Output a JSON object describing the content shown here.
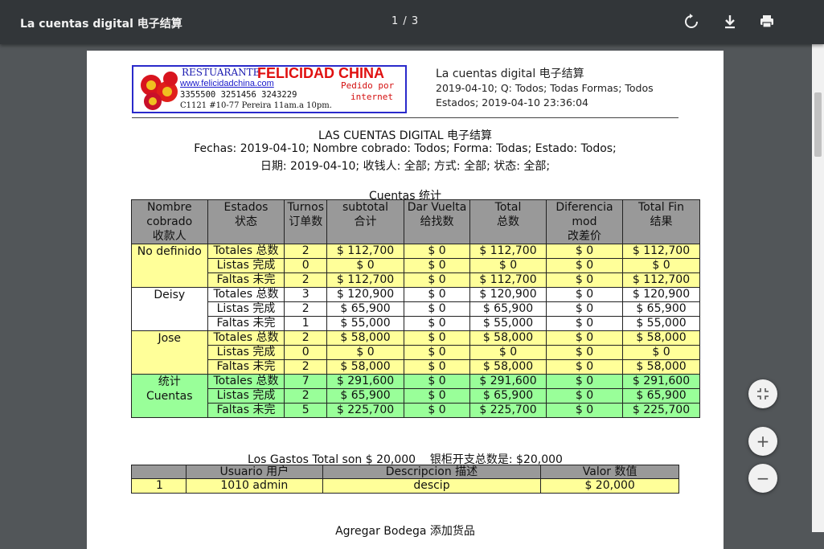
{
  "toolbar": {
    "title": "La cuentas digital 电子结算",
    "page_indicator": "1 / 3",
    "rotate_icon": "rotate-icon",
    "download_icon": "download-icon",
    "print_icon": "print-icon"
  },
  "logo": {
    "line1a": "RESTUARANTE",
    "line1b": "FELICIDAD CHINA",
    "website": "www.felicidadchina.com",
    "phones": "3355500 3251456 3243229",
    "pedido1": "Pedido por",
    "pedido2": "internet",
    "address": "C1121 #10-77 Pereira 11am.a 10pm."
  },
  "header": {
    "title": "La cuentas digital 电子结算",
    "line2": "2019-04-10; Q: Todos; Todas Formas; Todos",
    "line3": "Estados;  2019-04-10 23:36:04"
  },
  "report": {
    "title": "LAS CUENTAS DIGITAL 电子结算",
    "filters_es": "Fechas: 2019-04-10; Nombre cobrado: Todos; Forma: Todas; Estado: Todos;",
    "filters_zh": "日期: 2019-04-10; 收钱人: 全部; 方式: 全部; 状态: 全部;",
    "table_caption": "Cuentas 统计"
  },
  "columns": [
    "Nombre cobrado 收款人",
    "Estados 状态",
    "Turnos 订单数",
    "subtotal 合计",
    "Dar Vuelta 给找数",
    "Total 总数",
    "Diferencia mod 改差价",
    "Total Fin 结果"
  ],
  "groups": [
    {
      "name": "No definido",
      "rows": [
        {
          "estado": "Totales 总数",
          "turnos": "2",
          "subtotal": "$ 112,700",
          "vuelta": "$ 0",
          "total": "$ 112,700",
          "dif": "$ 0",
          "fin": "$ 112,700"
        },
        {
          "estado": "Listas 完成",
          "turnos": "0",
          "subtotal": "$ 0",
          "vuelta": "$ 0",
          "total": "$ 0",
          "dif": "$ 0",
          "fin": "$ 0"
        },
        {
          "estado": "Faltas 未完",
          "turnos": "2",
          "subtotal": "$ 112,700",
          "vuelta": "$ 0",
          "total": "$ 112,700",
          "dif": "$ 0",
          "fin": "$ 112,700"
        }
      ]
    },
    {
      "name": "Deisy",
      "rows": [
        {
          "estado": "Totales 总数",
          "turnos": "3",
          "subtotal": "$ 120,900",
          "vuelta": "$ 0",
          "total": "$ 120,900",
          "dif": "$ 0",
          "fin": "$ 120,900"
        },
        {
          "estado": "Listas 完成",
          "turnos": "2",
          "subtotal": "$ 65,900",
          "vuelta": "$ 0",
          "total": "$ 65,900",
          "dif": "$ 0",
          "fin": "$ 65,900"
        },
        {
          "estado": "Faltas 未完",
          "turnos": "1",
          "subtotal": "$ 55,000",
          "vuelta": "$ 0",
          "total": "$ 55,000",
          "dif": "$ 0",
          "fin": "$ 55,000"
        }
      ]
    },
    {
      "name": "Jose",
      "rows": [
        {
          "estado": "Totales 总数",
          "turnos": "2",
          "subtotal": "$ 58,000",
          "vuelta": "$ 0",
          "total": "$ 58,000",
          "dif": "$ 0",
          "fin": "$ 58,000"
        },
        {
          "estado": "Listas 完成",
          "turnos": "0",
          "subtotal": "$ 0",
          "vuelta": "$ 0",
          "total": "$ 0",
          "dif": "$ 0",
          "fin": "$ 0"
        },
        {
          "estado": "Faltas 未完",
          "turnos": "2",
          "subtotal": "$ 58,000",
          "vuelta": "$ 0",
          "total": "$ 58,000",
          "dif": "$ 0",
          "fin": "$ 58,000"
        }
      ]
    },
    {
      "name": "统计 Cuentas",
      "rows": [
        {
          "estado": "Totales 总数",
          "turnos": "7",
          "subtotal": "$ 291,600",
          "vuelta": "$ 0",
          "total": "$ 291,600",
          "dif": "$ 0",
          "fin": "$ 291,600"
        },
        {
          "estado": "Listas 完成",
          "turnos": "2",
          "subtotal": "$ 65,900",
          "vuelta": "$ 0",
          "total": "$ 65,900",
          "dif": "$ 0",
          "fin": "$ 65,900"
        },
        {
          "estado": "Faltas 未完",
          "turnos": "5",
          "subtotal": "$ 225,700",
          "vuelta": "$ 0",
          "total": "$ 225,700",
          "dif": "$ 0",
          "fin": "$ 225,700"
        }
      ]
    }
  ],
  "gastos": {
    "summary": "Los Gastos Total son $ 20,000    银柜开支总数是: $20,000",
    "columns": [
      "",
      "Usuario 用户",
      "Descripcion 描述",
      "Valor 数值"
    ],
    "rows": [
      {
        "n": "1",
        "usuario": "1010 admin",
        "desc": "descip",
        "valor": "$ 20,000"
      }
    ]
  },
  "next_section": "Agregar Bodega 添加货品",
  "zoom": {
    "fit_icon": "fit-page-icon",
    "zoom_in": "+",
    "zoom_out": "−"
  },
  "colors": {
    "toolbar_bg": "#323639",
    "viewer_bg": "#525659",
    "yellow_rows": "#ffff99",
    "green_rows": "#99ff99",
    "header_cells": "#999999"
  }
}
